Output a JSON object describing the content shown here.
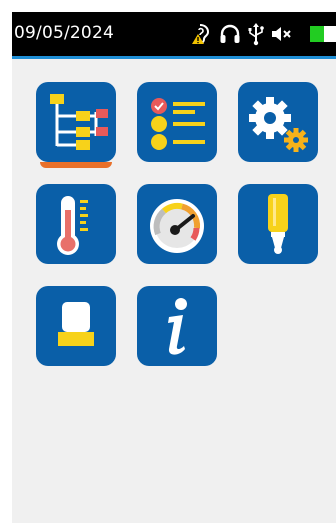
{
  "status_bar": {
    "date": "09/05/2024",
    "icons": [
      "hearing-warning-icon",
      "headphones-icon",
      "usb-icon",
      "speaker-muted-icon"
    ],
    "battery_level": 0.55
  },
  "menu": {
    "tiles": [
      {
        "name": "tree-structure-icon",
        "selected": true
      },
      {
        "name": "checklist-icon",
        "selected": false
      },
      {
        "name": "settings-gears-icon",
        "selected": false
      },
      {
        "name": "thermometer-icon",
        "selected": false
      },
      {
        "name": "gauge-icon",
        "selected": false
      },
      {
        "name": "probe-icon",
        "selected": false
      },
      {
        "name": "calibration-block-icon",
        "selected": false
      },
      {
        "name": "info-icon",
        "selected": false
      }
    ]
  },
  "colors": {
    "tile_blue": "#0a5fa8",
    "accent_orange": "#e8702a",
    "accent_yellow": "#f7d21a",
    "status_blue_line": "#1f8fd6"
  }
}
